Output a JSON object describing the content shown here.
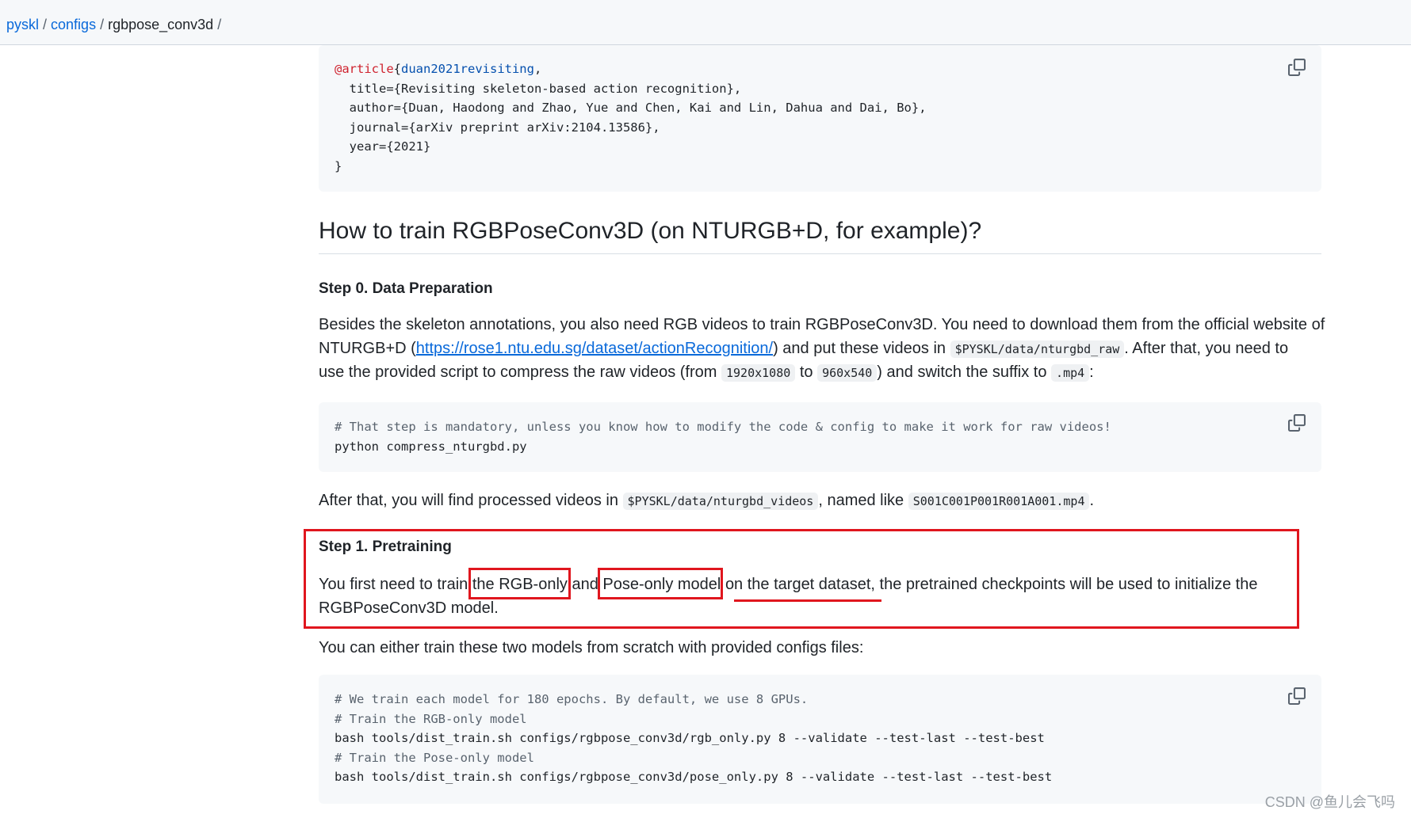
{
  "breadcrumb": {
    "items": [
      {
        "label": "pyskl"
      },
      {
        "label": "configs"
      }
    ],
    "current": "rgbpose_conv3d",
    "separator": "/"
  },
  "bibtex": {
    "lines": [
      [
        {
          "cls": "kw",
          "t": "@article"
        },
        {
          "cls": "",
          "t": "{"
        },
        {
          "cls": "id",
          "t": "duan2021revisiting"
        },
        {
          "cls": "",
          "t": ","
        }
      ],
      [
        {
          "cls": "",
          "t": "  title={Revisiting skeleton-based action recognition},"
        }
      ],
      [
        {
          "cls": "",
          "t": "  author={Duan, Haodong and Zhao, Yue and Chen, Kai and Lin, Dahua and Dai, Bo},"
        }
      ],
      [
        {
          "cls": "",
          "t": "  journal={arXiv preprint arXiv:2104.13586},"
        }
      ],
      [
        {
          "cls": "",
          "t": "  year={2021}"
        }
      ],
      [
        {
          "cls": "",
          "t": "}"
        }
      ]
    ]
  },
  "heading": "How to train RGBPoseConv3D (on NTURGB+D, for example)?",
  "step0": {
    "title": "Step 0. Data Preparation",
    "line1": "Besides the skeleton annotations, you also need RGB videos to train RGBPoseConv3D. You need to download them from the official website of",
    "line2_pre": "NTURGB+D (",
    "link": "https://rose1.ntu.edu.sg/dataset/actionRecognition/",
    "line2_mid": ") and put these videos in ",
    "code_path": "$PYSKL/data/nturgbd_raw",
    "line2_post": ". After that, you need to",
    "line3_pre": "use the provided script to compress the raw videos (from ",
    "code_from": "1920x1080",
    "line3_to": " to ",
    "code_to": "960x540",
    "line3_mid": ") and switch the suffix to ",
    "code_suffix": ".mp4",
    "line3_post": ":",
    "code_lines": [
      [
        {
          "cls": "cm",
          "t": "# That step is mandatory, unless you know how to modify the code & config to make it work for raw videos!"
        }
      ],
      [
        {
          "cls": "",
          "t": "python compress_nturgbd.py"
        }
      ]
    ],
    "after_pre": "After that, you will find processed videos in ",
    "after_code1": "$PYSKL/data/nturgbd_videos",
    "after_mid": ", named like ",
    "after_code2": "S001C001P001R001A001.mp4",
    "after_post": "."
  },
  "step1": {
    "title": "Step 1. Pretraining",
    "p1_a": "You first need to train",
    "p1_b": "the RGB-only",
    "p1_c": "and",
    "p1_d": "Pose-only model",
    "p1_e": "on the target dataset",
    "p1_f": ", the pretrained checkpoints will be used to initialize the",
    "p1_line2": "RGBPoseConv3D model.",
    "p2": "You can either train these two models from scratch with provided configs files:",
    "code_lines": [
      [
        {
          "cls": "cm",
          "t": "# We train each model for 180 epochs. By default, we use 8 GPUs."
        }
      ],
      [
        {
          "cls": "cm",
          "t": "# Train the RGB-only model"
        }
      ],
      [
        {
          "cls": "",
          "t": "bash tools/dist_train.sh configs/rgbpose_conv3d/rgb_only.py 8 --validate --test-last --test-best"
        }
      ],
      [
        {
          "cls": "cm",
          "t": "# Train the Pose-only model"
        }
      ],
      [
        {
          "cls": "",
          "t": "bash tools/dist_train.sh configs/rgbpose_conv3d/pose_only.py 8 --validate --test-last --test-best"
        }
      ]
    ]
  },
  "copy_icon": "copy-icon",
  "watermark": "CSDN @鱼儿会飞吗",
  "colors": {
    "link": "#0969da",
    "annotation_red": "#e0161e",
    "code_bg": "#f6f8fa"
  }
}
